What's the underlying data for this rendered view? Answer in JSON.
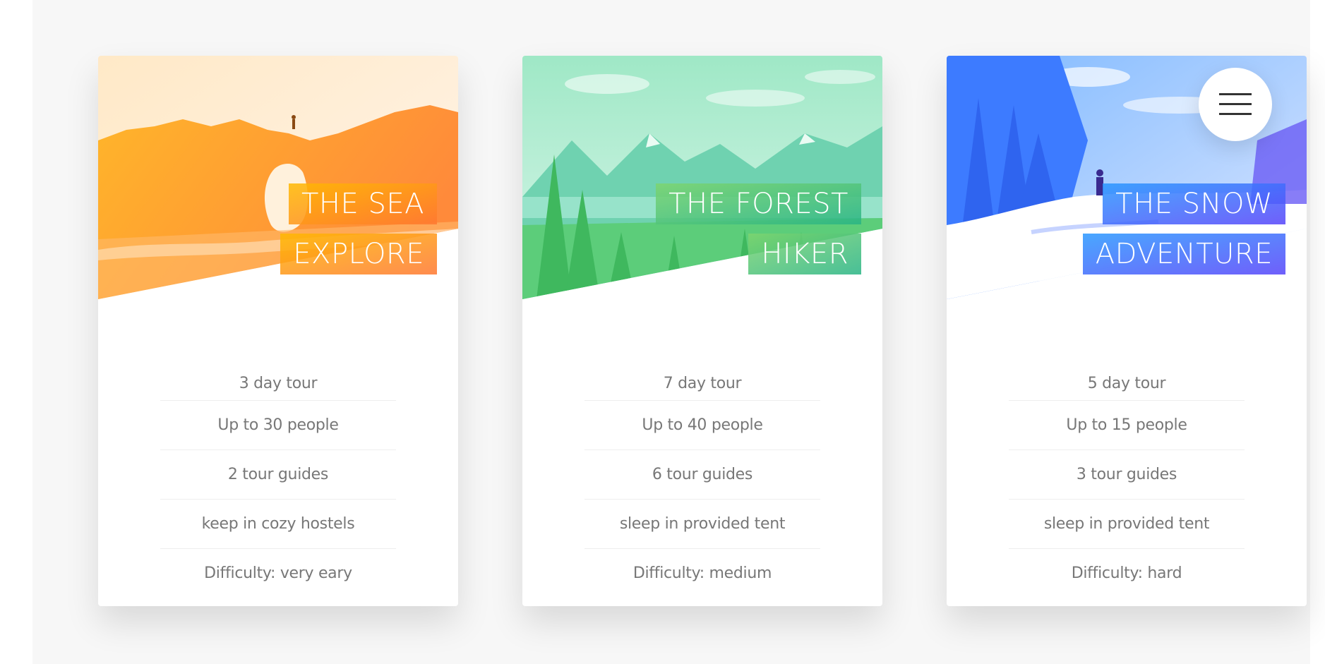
{
  "colors": {
    "sea_gradient": [
      "#ffb900",
      "#ff7730"
    ],
    "forest_gradient": [
      "#7ed56f",
      "#28b485"
    ],
    "snow_gradient": [
      "#2998ff",
      "#5643fa"
    ],
    "detail_text": "#777777",
    "page_background": "#f7f7f7"
  },
  "navigation": {
    "menu_icon": "hamburger-menu-icon"
  },
  "cards": [
    {
      "heading_line1": "THE SEA",
      "heading_line2": "EXPLORE",
      "picture": "sea-rock-arch-photo",
      "details": [
        "3 day tour",
        "Up to 30 people",
        "2 tour guides",
        "keep in cozy hostels",
        "Difficulty: very eary"
      ]
    },
    {
      "heading_line1": "THE FOREST",
      "heading_line2": "HIKER",
      "picture": "forest-mountains-photo",
      "details": [
        "7 day tour",
        "Up to 40 people",
        "6 tour guides",
        "sleep in provided tent",
        "Difficulty: medium"
      ]
    },
    {
      "heading_line1": "THE SNOW",
      "heading_line2": "ADVENTURE",
      "picture": "snow-mountain-trail-photo",
      "details": [
        "5 day tour",
        "Up to 15 people",
        "3 tour guides",
        "sleep in provided tent",
        "Difficulty: hard"
      ]
    }
  ]
}
